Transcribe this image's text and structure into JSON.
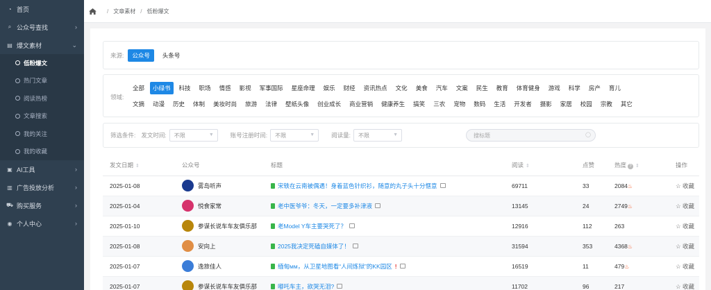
{
  "sidebar": {
    "items": [
      {
        "label": "首页",
        "icon": "dashboard-icon",
        "chevron": false
      },
      {
        "label": "公众号查找",
        "icon": "search-icon",
        "chevron": true
      },
      {
        "label": "爆文素材",
        "icon": "document-icon",
        "chevron": true,
        "open": true
      }
    ],
    "subitems": [
      "低粉爆文",
      "热门文章",
      "阅读热榜",
      "文章搜索",
      "我的关注",
      "我的收藏"
    ],
    "active_subitem": "低粉爆文",
    "bottom_items": [
      {
        "label": "AI工具",
        "icon": "ai-icon"
      },
      {
        "label": "广告投放分析",
        "icon": "bar-chart-icon"
      },
      {
        "label": "购买服务",
        "icon": "cart-icon"
      },
      {
        "label": "个人中心",
        "icon": "user-icon"
      }
    ]
  },
  "breadcrumb": [
    "文章素材",
    "低粉爆文"
  ],
  "source": {
    "label": "来源:",
    "options": [
      "公众号",
      "头条号"
    ],
    "selected": "公众号"
  },
  "fields": {
    "label": "领域:",
    "row1": [
      "全部",
      "小绿书",
      "科技",
      "职场",
      "情感",
      "影视",
      "军事国际",
      "星座命理",
      "娱乐",
      "财经",
      "资讯热点",
      "文化",
      "美食",
      "汽车",
      "文案",
      "民生",
      "教育",
      "体育健身",
      "游戏",
      "科学",
      "房产",
      "育儿"
    ],
    "row2": [
      "文摘",
      "动漫",
      "历史",
      "体制",
      "美妆时尚",
      "旅游",
      "法律",
      "壁纸头像",
      "创业成长",
      "商业营销",
      "健康养生",
      "搞笑",
      "三农",
      "宠物",
      "数码",
      "生活",
      "开发者",
      "摄影",
      "家居",
      "校园",
      "宗教",
      "其它"
    ],
    "selected": "小绿书"
  },
  "filters": {
    "label": "筛选条件:",
    "publish_time_label": "发文时间:",
    "publish_time_value": "不限",
    "register_time_label": "账号注册时间:",
    "register_time_value": "不限",
    "reads_label": "阅读量:",
    "reads_value": "不限",
    "search_placeholder": "搜标题"
  },
  "table": {
    "headers": {
      "date": "发文日期",
      "account": "公众号",
      "title": "标题",
      "reads": "阅读",
      "likes": "点赞",
      "heat": "热度",
      "action": "操作"
    },
    "action_label": "收藏",
    "rows": [
      {
        "date": "2025-01-08",
        "account": "雾岛听声",
        "avatar_color": "#1a3a8f",
        "title": "宋轶在云南被偶遇！身着蓝色针织衫，随意的丸子头十分惬意",
        "warn": false,
        "reads": "69711",
        "likes": "33",
        "heat": "2084",
        "hot": true
      },
      {
        "date": "2025-01-04",
        "account": "悦食家常",
        "avatar_color": "#d6336c",
        "title": "老中医爷爷：冬天，一定要多补津液",
        "warn": false,
        "reads": "13145",
        "likes": "24",
        "heat": "2749",
        "hot": true
      },
      {
        "date": "2025-01-10",
        "account": "参谋长说车车友俱乐部",
        "avatar_color": "#b8860b",
        "title": "老Model Y车主要哭死了？",
        "warn": false,
        "reads": "12916",
        "likes": "112",
        "heat": "263",
        "hot": false
      },
      {
        "date": "2025-01-08",
        "account": "安向上",
        "avatar_color": "#e08e45",
        "title": "2025我决定死磕自媒体了！",
        "warn": false,
        "reads": "31594",
        "likes": "353",
        "heat": "4368",
        "hot": true
      },
      {
        "date": "2025-01-07",
        "account": "逸旅佳人",
        "avatar_color": "#3b7dd8",
        "title": "缅甸мм，从卫星地图看“人间炼狱”的KK园区",
        "warn": true,
        "reads": "16519",
        "likes": "11",
        "heat": "479",
        "hot": true
      },
      {
        "date": "2025-01-07",
        "account": "参谋长说车车友俱乐部",
        "avatar_color": "#b8860b",
        "title": "嘟吒车主，欲哭无泪?",
        "warn": false,
        "reads": "11702",
        "likes": "96",
        "heat": "217",
        "hot": false
      }
    ]
  }
}
